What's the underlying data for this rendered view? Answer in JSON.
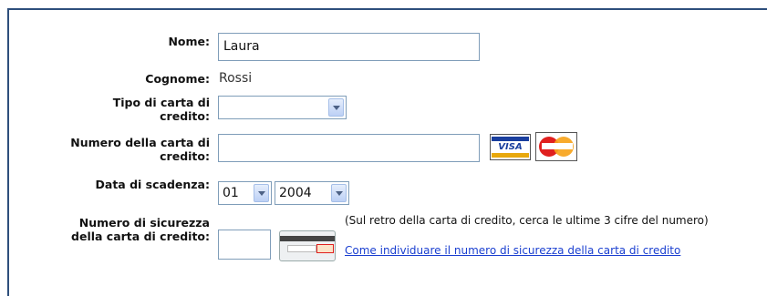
{
  "form": {
    "nome_label": "Nome:",
    "nome_value": "Laura",
    "cognome_label": "Cognome:",
    "cognome_value": "Rossi",
    "tipo_carta_label_1": "Tipo di carta di",
    "tipo_carta_label_2": "credito:",
    "tipo_carta_value": "",
    "numero_carta_label_1": "Numero della carta di",
    "numero_carta_label_2": "credito:",
    "numero_carta_value": "",
    "card_logos": {
      "visa": "VISA",
      "mastercard": "MasterCard"
    },
    "scadenza_label": "Data di scadenza:",
    "scadenza_mese": "01",
    "scadenza_anno": "2004",
    "sicurezza_label_1": "Numero di sicurezza",
    "sicurezza_label_2": "della carta di credito:",
    "sicurezza_value": "",
    "sicurezza_note": "(Sul retro della carta di credito, cerca le ultime 3 cifre del numero)",
    "sicurezza_link": "Come individuare il numero di sicurezza della carta di credito"
  },
  "colors": {
    "frame": "#2e4f7c",
    "input_border": "#7f9db9",
    "link": "#1a3fd0"
  }
}
